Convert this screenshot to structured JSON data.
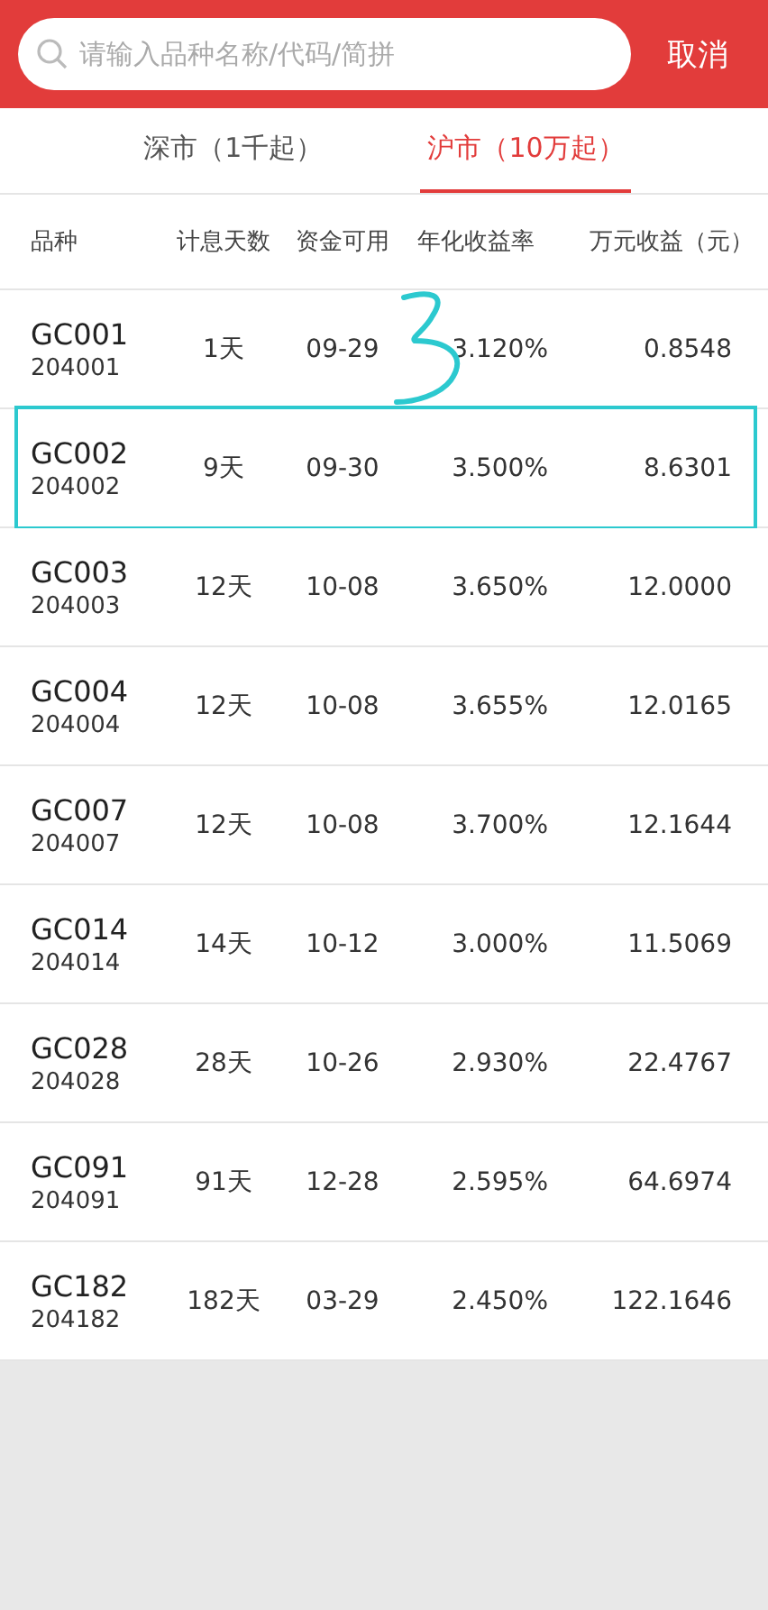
{
  "search": {
    "placeholder": "请输入品种名称/代码/简拼",
    "cancel": "取消"
  },
  "tabs": [
    {
      "label": "深市（1千起）",
      "selected": false
    },
    {
      "label": "沪市（10万起）",
      "selected": true
    }
  ],
  "table": {
    "columns": [
      "品种",
      "计息天数",
      "资金可用",
      "年化收益率",
      "万元收益（元）"
    ],
    "rows": [
      {
        "name": "GC001",
        "code": "204001",
        "days": "1天",
        "available": "09-29",
        "rate": "3.120%",
        "income": "0.8548",
        "boxed": false,
        "scribble": true
      },
      {
        "name": "GC002",
        "code": "204002",
        "days": "9天",
        "available": "09-30",
        "rate": "3.500%",
        "income": "8.6301",
        "boxed": true,
        "scribble": false
      },
      {
        "name": "GC003",
        "code": "204003",
        "days": "12天",
        "available": "10-08",
        "rate": "3.650%",
        "income": "12.0000",
        "boxed": false,
        "scribble": false
      },
      {
        "name": "GC004",
        "code": "204004",
        "days": "12天",
        "available": "10-08",
        "rate": "3.655%",
        "income": "12.0165",
        "boxed": false,
        "scribble": false
      },
      {
        "name": "GC007",
        "code": "204007",
        "days": "12天",
        "available": "10-08",
        "rate": "3.700%",
        "income": "12.1644",
        "boxed": false,
        "scribble": false
      },
      {
        "name": "GC014",
        "code": "204014",
        "days": "14天",
        "available": "10-12",
        "rate": "3.000%",
        "income": "11.5069",
        "boxed": false,
        "scribble": false
      },
      {
        "name": "GC028",
        "code": "204028",
        "days": "28天",
        "available": "10-26",
        "rate": "2.930%",
        "income": "22.4767",
        "boxed": false,
        "scribble": false
      },
      {
        "name": "GC091",
        "code": "204091",
        "days": "91天",
        "available": "12-28",
        "rate": "2.595%",
        "income": "64.6974",
        "boxed": false,
        "scribble": false
      },
      {
        "name": "GC182",
        "code": "204182",
        "days": "182天",
        "available": "03-29",
        "rate": "2.450%",
        "income": "122.1646",
        "boxed": false,
        "scribble": false
      }
    ]
  }
}
